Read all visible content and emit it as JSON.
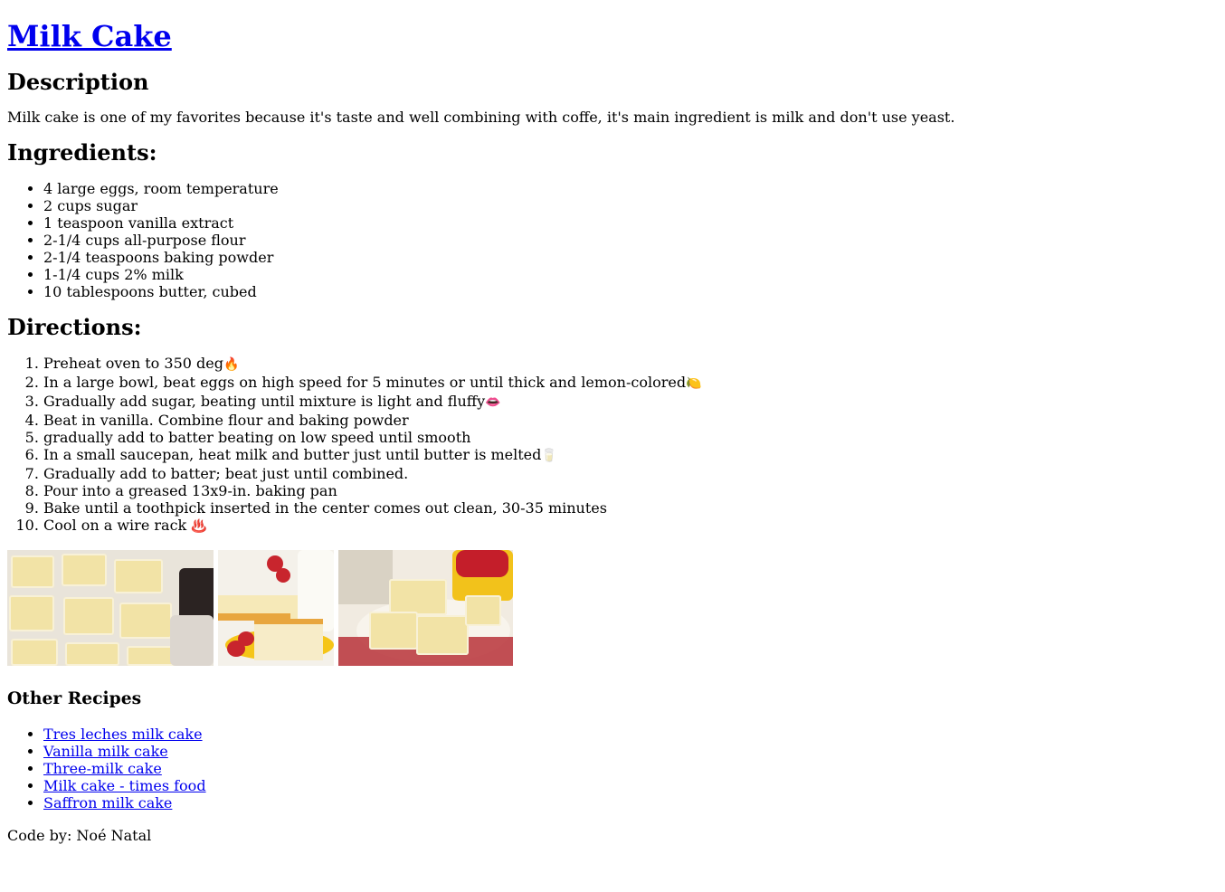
{
  "title": "Milk Cake",
  "description": {
    "heading": "Description",
    "text": "Milk cake is one of my favorites because it's taste and well combining with coffe, it's main ingredient is milk and don't use yeast."
  },
  "ingredients": {
    "heading": "Ingredients:",
    "items": [
      "4 large eggs, room temperature",
      "2 cups sugar",
      "1 teaspoon vanilla extract",
      "2-1/4 cups all-purpose flour",
      "2-1/4 teaspoons baking powder",
      "1-1/4 cups 2% milk",
      "10 tablespoons butter, cubed"
    ]
  },
  "directions": {
    "heading": "Directions:",
    "steps": [
      {
        "text": "Preheat oven to 350 deg",
        "emoji": "🔥"
      },
      {
        "text": "In a large bowl, beat eggs on high speed for 5 minutes or until thick and lemon-colored",
        "emoji": "🍋"
      },
      {
        "text": "Gradually add sugar, beating until mixture is light and fluffy",
        "emoji": "👄"
      },
      {
        "text": "Beat in vanilla. Combine flour and baking powder",
        "emoji": ""
      },
      {
        "text": "gradually add to batter beating on low speed until smooth",
        "emoji": ""
      },
      {
        "text": "In a small saucepan, heat milk and butter just until butter is melted",
        "emoji": "🥛"
      },
      {
        "text": "Gradually add to batter; beat just until combined.",
        "emoji": ""
      },
      {
        "text": "Pour into a greased 13x9-in. baking pan",
        "emoji": ""
      },
      {
        "text": "Bake until a toothpick inserted in the center comes out clean, 30-35 minutes",
        "emoji": ""
      },
      {
        "text": "Cool on a wire rack ",
        "emoji": "♨️"
      }
    ]
  },
  "gallery": {
    "photos": [
      "milk-cake-squares-photo",
      "milk-cake-slice-photo",
      "milk-cake-plate-photo"
    ]
  },
  "other_recipes": {
    "heading": "Other Recipes",
    "links": [
      "Tres leches milk cake",
      "Vanilla milk cake",
      "Three-milk cake",
      "Milk cake - times food",
      "Saffron milk cake"
    ]
  },
  "credit": "Code by: Noé Natal"
}
